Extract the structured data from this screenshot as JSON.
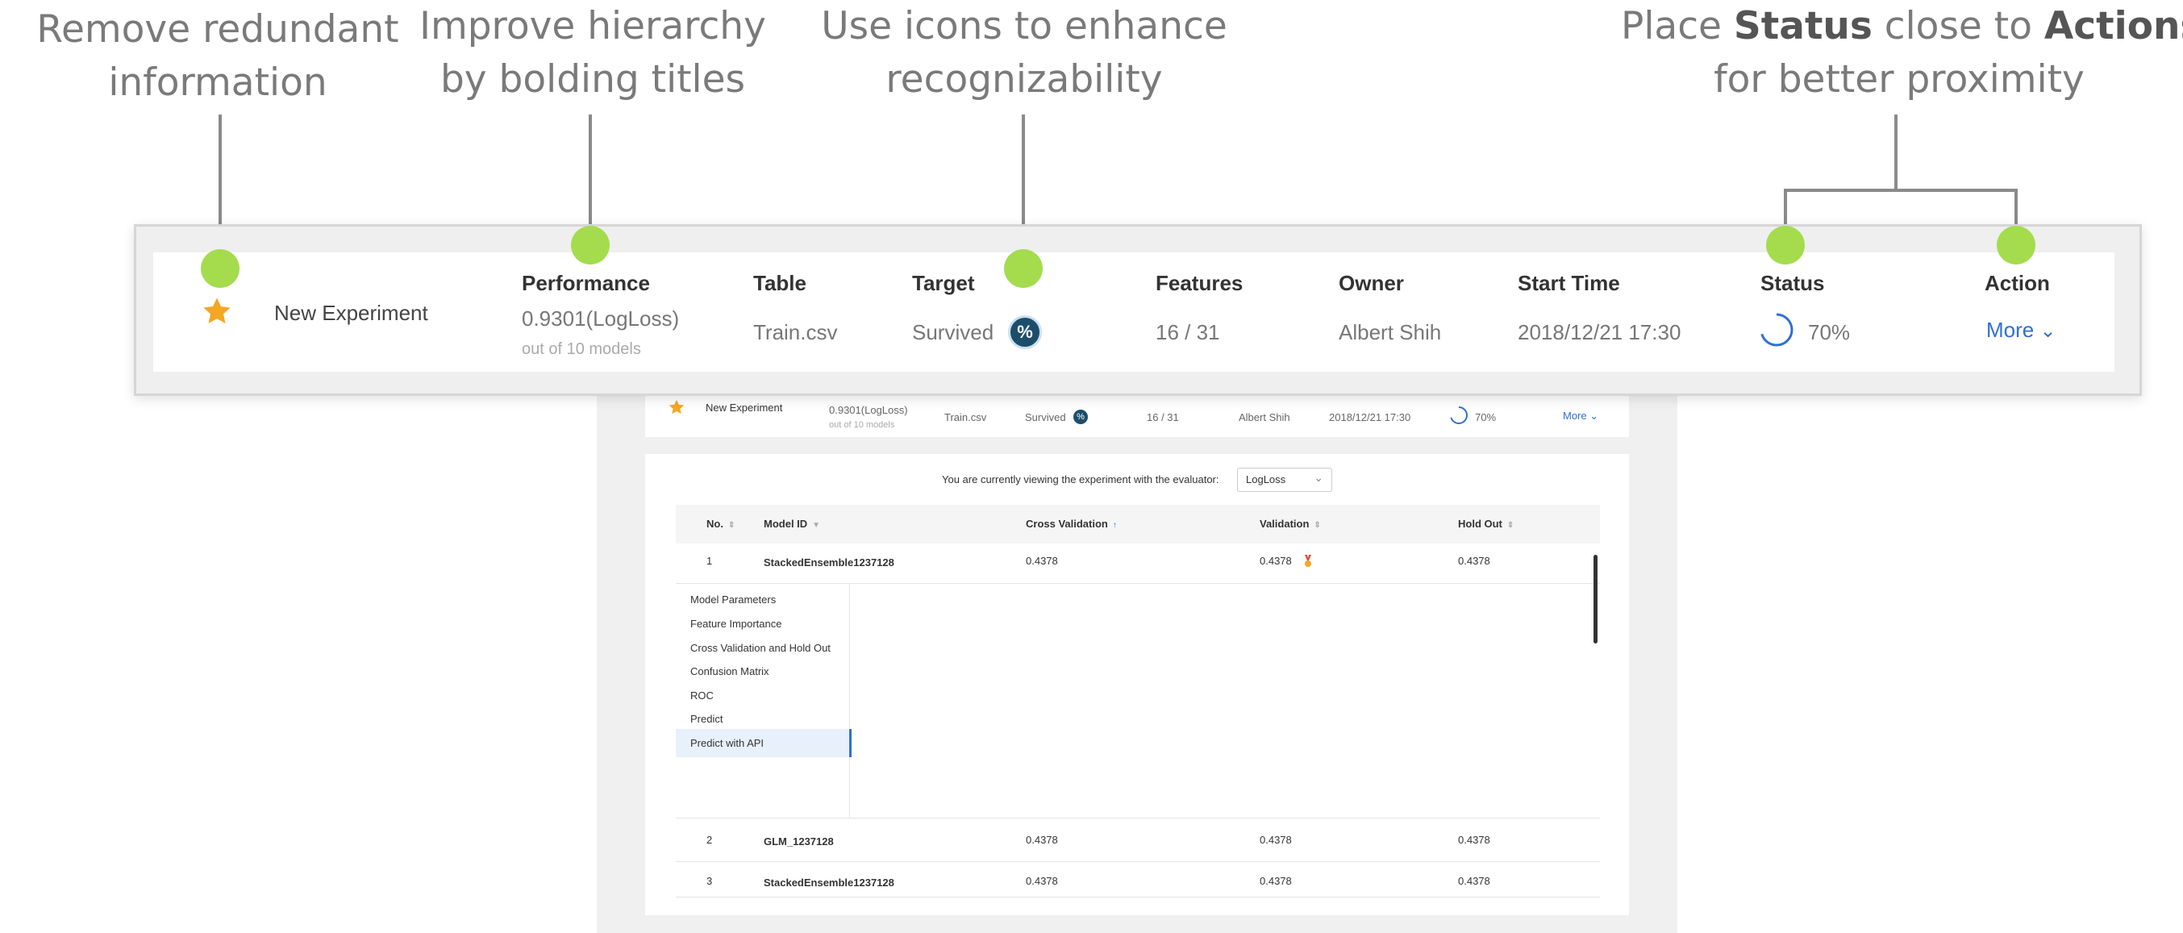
{
  "annotations": {
    "remove_redundant_1": "Remove redundant",
    "remove_redundant_2": "information",
    "hierarchy_1": "Improve hierarchy",
    "hierarchy_2": "by bolding titles",
    "icons_1": "Use icons to enhance",
    "icons_2": "recognizability",
    "status_prefix": "Place ",
    "status_bold": "Status",
    "status_mid": " close to ",
    "status_bold2": "Actions",
    "status_line2": "for better proximity"
  },
  "colors": {
    "accent": "#2f6fd6",
    "dot": "#a4dc4d",
    "star": "#f5a623",
    "target_icon": "#1c4e6b"
  },
  "banner": {
    "experiment_name": "New Experiment",
    "headers": {
      "performance": "Performance",
      "table": "Table",
      "target": "Target",
      "features": "Features",
      "owner": "Owner",
      "start_time": "Start Time",
      "status": "Status",
      "action": "Action"
    },
    "performance_value": "0.9301(LogLoss)",
    "performance_sub": "out of 10 models",
    "table_value": "Train.csv",
    "target_value": "Survived",
    "features_value": "16 / 31",
    "owner_value": "Albert Shih",
    "start_time_value": "2018/12/21 17:30",
    "status_value": "70%",
    "status_progress": 0.7,
    "action_label": "More"
  },
  "app": {
    "summary": {
      "experiment_name": "New Experiment",
      "performance_value": "0.9301(LogLoss)",
      "performance_sub": "out of 10 models",
      "table_value": "Train.csv",
      "target_value": "Survived",
      "features_value": "16 / 31",
      "owner_value": "Albert Shih",
      "start_time_value": "2018/12/21 17:30",
      "status_value": "70%",
      "action_label": "More"
    },
    "evaluator_text": "You are currently viewing the experiment with the evaluator:",
    "evaluator_value": "LogLoss",
    "columns": {
      "no": "No.",
      "model_id": "Model ID",
      "cross_validation": "Cross Validation",
      "validation": "Validation",
      "hold_out": "Hold Out"
    },
    "rows": [
      {
        "no": "1",
        "model_id": "StackedEnsemble1237128",
        "cv": "0.4378",
        "val": "0.4378",
        "hold": "0.4378"
      },
      {
        "no": "2",
        "model_id": "GLM_1237128",
        "cv": "0.4378",
        "val": "0.4378",
        "hold": "0.4378"
      },
      {
        "no": "3",
        "model_id": "StackedEnsemble1237128",
        "cv": "0.4378",
        "val": "0.4378",
        "hold": "0.4378"
      }
    ],
    "detail_menu": [
      "Model Parameters",
      "Feature Importance",
      "Cross Validation and Hold Out",
      "Confusion Matrix",
      "ROC",
      "Predict",
      "Predict with API"
    ]
  }
}
